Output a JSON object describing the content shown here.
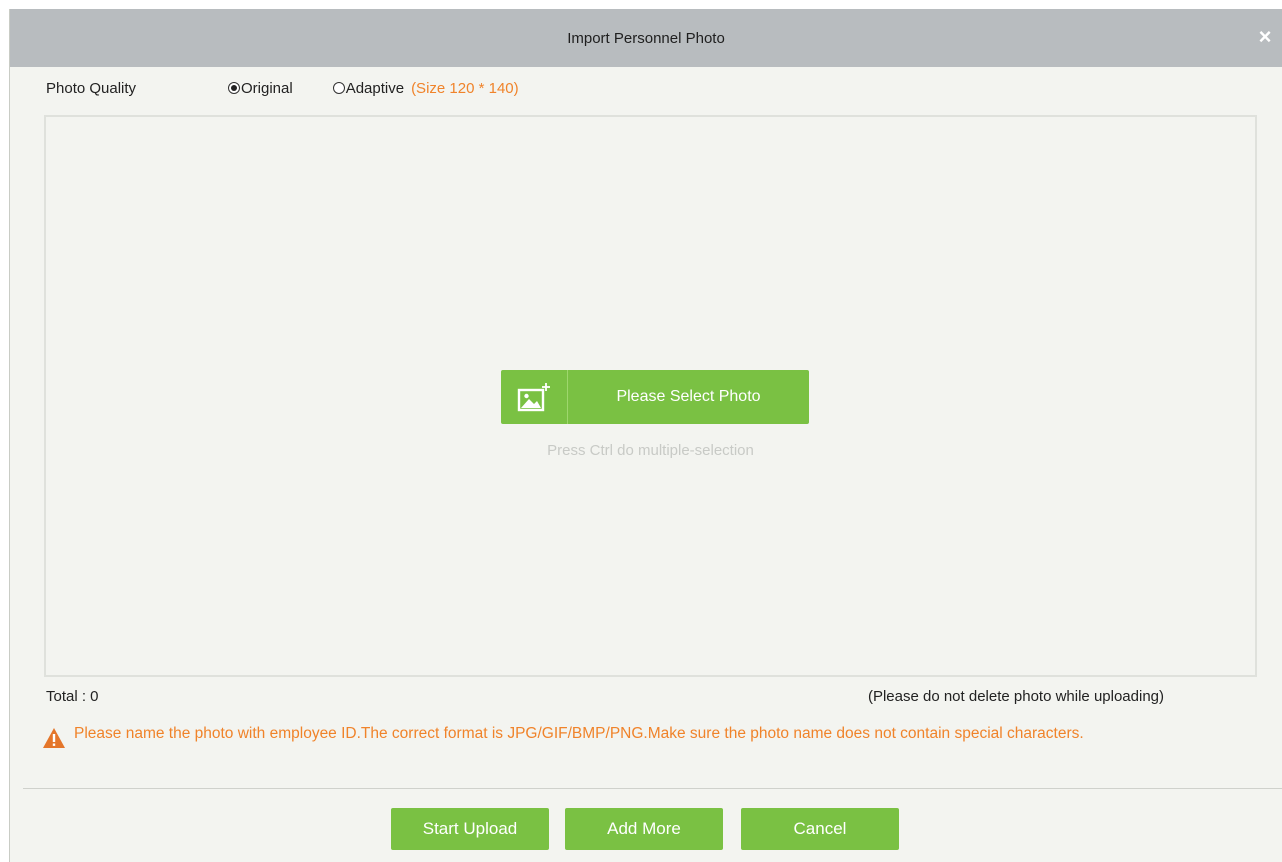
{
  "dialog": {
    "title": "Import Personnel Photo",
    "close_glyph": "×"
  },
  "quality": {
    "label": "Photo Quality",
    "options": [
      {
        "label": "Original",
        "checked": true
      },
      {
        "label": "Adaptive",
        "checked": false
      }
    ],
    "size_hint": "(Size 120 * 140)"
  },
  "dropzone": {
    "select_button_label": "Please Select Photo",
    "select_button_icon": "add-image-icon",
    "hint": "Press Ctrl do multiple-selection"
  },
  "status": {
    "total_text": "Total : 0",
    "upload_note": "(Please do not delete photo while uploading)"
  },
  "warning": {
    "icon": "warning-icon",
    "text": "Please name the photo with employee ID.The correct format is JPG/GIF/BMP/PNG.Make sure the photo name does not contain special characters."
  },
  "footer": {
    "start_upload": "Start Upload",
    "add_more": "Add More",
    "cancel": "Cancel"
  },
  "colors": {
    "accent_green": "#7ac143",
    "warning_orange": "#f0832a",
    "title_bar": "#b8bcbf",
    "panel_bg": "#f3f4f0"
  }
}
